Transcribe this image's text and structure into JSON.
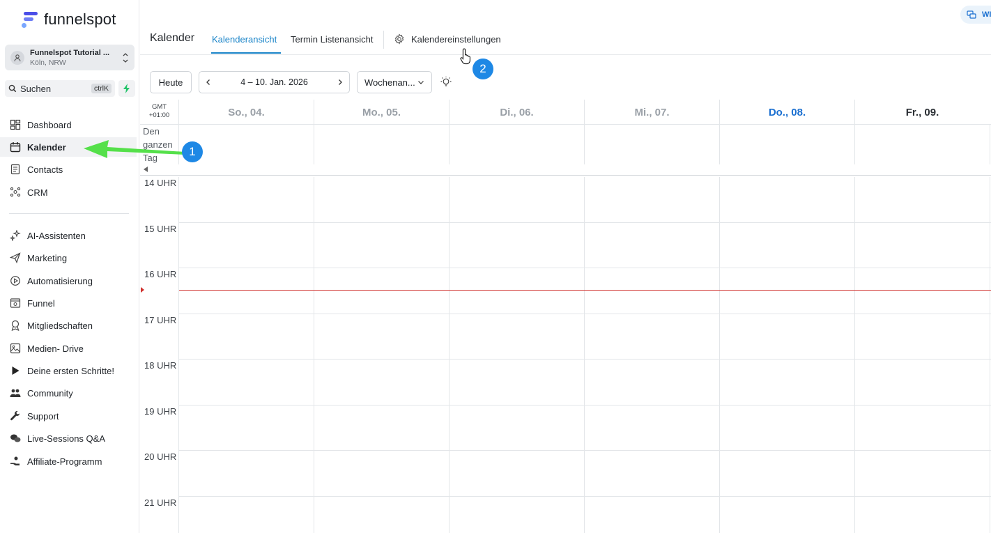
{
  "brand": {
    "name": "funnelspot"
  },
  "account": {
    "name": "Funnelspot Tutorial ...",
    "location": "Köln, NRW"
  },
  "search": {
    "label": "Suchen",
    "shortcut": "ctrlK"
  },
  "sidebar": {
    "items": [
      {
        "label": "Dashboard",
        "icon": "dashboard-icon"
      },
      {
        "label": "Kalender",
        "icon": "calendar-icon",
        "active": true
      },
      {
        "label": "Contacts",
        "icon": "contacts-icon"
      },
      {
        "label": "CRM",
        "icon": "crm-icon"
      },
      {
        "label": "AI-Assistenten",
        "icon": "sparkle-icon"
      },
      {
        "label": "Marketing",
        "icon": "send-icon"
      },
      {
        "label": "Automatisierung",
        "icon": "automation-icon"
      },
      {
        "label": "Funnel",
        "icon": "funnel-icon"
      },
      {
        "label": "Mitgliedschaften",
        "icon": "badge-icon"
      },
      {
        "label": "Medien- Drive",
        "icon": "image-icon"
      },
      {
        "label": "Deine ersten Schritte!",
        "icon": "play-icon"
      },
      {
        "label": "Community",
        "icon": "users-icon"
      },
      {
        "label": "Support",
        "icon": "wrench-icon"
      },
      {
        "label": "Live-Sessions Q&A",
        "icon": "chat-icon"
      },
      {
        "label": "Affiliate-Programm",
        "icon": "affiliate-icon"
      }
    ]
  },
  "header": {
    "title": "Kalender",
    "tabs": [
      {
        "label": "Kalenderansicht",
        "active": true
      },
      {
        "label": "Termin Listenansicht"
      },
      {
        "label": "Kalendereinstellungen",
        "icon": "gear-icon"
      }
    ],
    "top_right_label": "WI"
  },
  "toolbar": {
    "today": "Heute",
    "date_range": "4 – 10. Jan. 2026",
    "view": "Wochenan..."
  },
  "calendar": {
    "tz_line1": "GMT",
    "tz_line2": "+01:00",
    "allday_label": "Den ganzen Tag",
    "days": [
      {
        "label": "So., 04."
      },
      {
        "label": "Mo., 05."
      },
      {
        "label": "Di., 06."
      },
      {
        "label": "Mi., 07."
      },
      {
        "label": "Do., 08.",
        "today": true
      },
      {
        "label": "Fr., 09."
      }
    ],
    "hours": [
      "14 UHR",
      "15 UHR",
      "16 UHR",
      "17 UHR",
      "18 UHR",
      "19 UHR",
      "20 UHR",
      "21 UHR"
    ]
  },
  "annotations": {
    "step1": "1",
    "step2": "2"
  },
  "colors": {
    "accent": "#1a84c8",
    "today": "#1a6fd0",
    "now_line": "#d0312d",
    "badge": "#1e88e5",
    "arrow": "#55e04a"
  }
}
